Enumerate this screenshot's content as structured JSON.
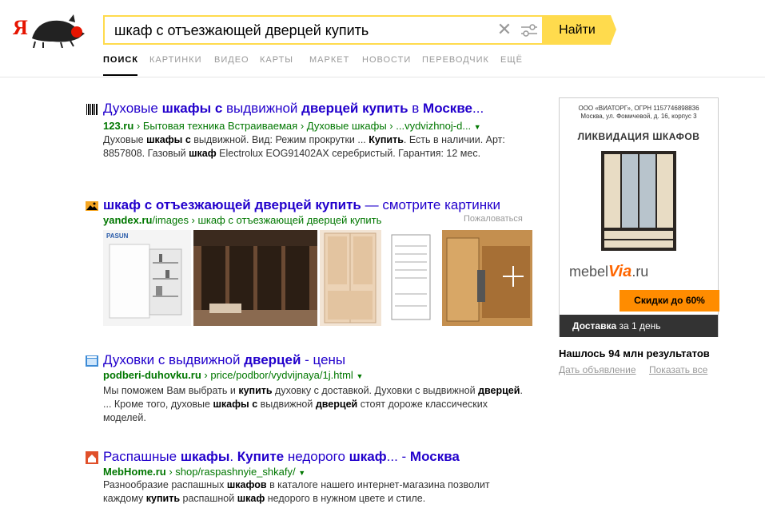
{
  "logo": {
    "text": "Я"
  },
  "search": {
    "query": "шкаф с отъезжающей дверцей купить",
    "button_label": "Найти"
  },
  "nav": {
    "tabs": [
      {
        "label": "ПОИСК",
        "active": true
      },
      {
        "label": "КАРТИНКИ"
      },
      {
        "label": "ВИДЕО"
      },
      {
        "label": "КАРТЫ"
      },
      {
        "label": "МАРКЕТ"
      },
      {
        "label": "НОВОСТИ"
      },
      {
        "label": "ПЕРЕВОДЧИК"
      },
      {
        "label": "ЕЩЁ"
      }
    ]
  },
  "results": [
    {
      "icon": "barcode-icon",
      "title_parts": [
        "Духовые ",
        "шкафы с",
        " выдвижной ",
        "дверцей купить",
        " в ",
        "Москве",
        "..."
      ],
      "url_domain": "123.ru",
      "url_path": " › Бытовая техника Встраиваемая › Духовые шкафы › ...vydvizhnoj-d...",
      "snippet_parts": [
        "Духовые ",
        "шкафы с",
        " выдвижной. Вид: Режим прокрутки ... ",
        "Купить",
        ". Есть в наличии. Арт: 8857808. Газовый ",
        "шкаф",
        " Electrolux EOG91402AX серебристый. Гарантия: 12 мес."
      ]
    },
    {
      "icon": "images-icon",
      "title_bold": "шкаф с отъезжающей дверцей купить",
      "title_rest": " — смотрите картинки",
      "url_domain": "yandex.ru",
      "url_path": "/images › шкаф с отъезжающей дверцей купить",
      "complain": "Пожаловаться"
    },
    {
      "icon": "oven-icon",
      "title_parts": [
        "Духовки с выдвижной ",
        "дверцей",
        " - цены"
      ],
      "url_domain": "podberi-duhovku.ru",
      "url_path": " › price/podbor/vydvijnaya/1j.html",
      "snippet_parts": [
        "Мы поможем Вам выбрать и ",
        "купить",
        " духовку с доставкой. Духовки с выдвижной ",
        "дверцей",
        ". ... Кроме того, духовые ",
        "шкафы с",
        " выдвижной ",
        "дверцей",
        " стоят дороже классических моделей."
      ]
    },
    {
      "icon": "mebhome-icon",
      "title_parts": [
        "Распашные ",
        "шкафы",
        ". ",
        "Купите",
        " недорого ",
        "шкаф",
        "... - ",
        "Москва"
      ],
      "url_domain": "MebHome.ru",
      "url_path": " › shop/raspashnyie_shkafy/",
      "snippet_parts": [
        "Разнообразие распашных ",
        "шкафов",
        " в каталоге нашего интернет-магазина позволит каждому ",
        "купить",
        " распашной ",
        "шкаф",
        " недорого в нужном цвете и стиле."
      ]
    }
  ],
  "thumb_texts": {
    "pasun": "PASUN"
  },
  "ad": {
    "company": "ООО «ВИАТОРГ», ОГРН 1157746898836",
    "address": "Москва, ул. Фомичевой, д. 16, корпус 3",
    "title": "ЛИКВИДАЦИЯ ШКАФОВ",
    "logo_prefix": "mebel",
    "logo_brand": "Via",
    "logo_suffix": ".ru",
    "discount": "Скидки до 60%",
    "delivery_bold": "Доставка",
    "delivery_rest": " за 1 день"
  },
  "sidebar": {
    "found": "Нашлось 94 млн результатов",
    "link_ad": "Дать объявление",
    "link_all": "Показать все"
  },
  "colors": {
    "accent": "#ffdb4d",
    "title_link": "#2200cc",
    "url_green": "#007700"
  }
}
